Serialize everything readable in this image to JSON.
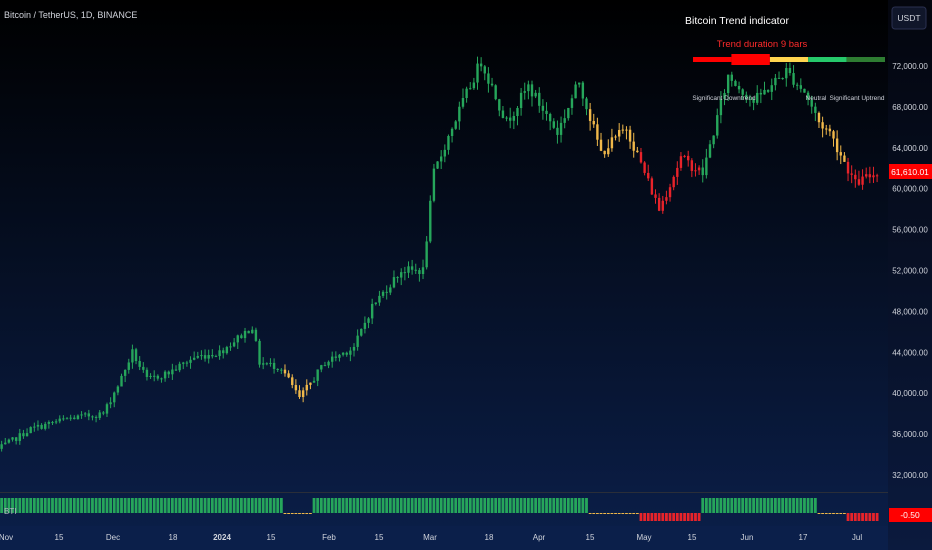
{
  "header": {
    "symbol": "Bitcoin / TetherUS, 1D, BINANCE"
  },
  "currency_button": {
    "label": "USDT"
  },
  "indicator": {
    "title": "Bitcoin Trend indicator",
    "duration_label": "Trend duration 9 bars",
    "labels": {
      "significant_downtrend": "Significant Downtrend",
      "neutral": "Neutral",
      "significant_uptrend": "Significant Uptrend"
    },
    "legend_colors": [
      "#ff0000",
      "#ff0000",
      "#ffd54f",
      "#26c96b",
      "#2e7d32"
    ],
    "current_marker_segment": 1
  },
  "price_axis": {
    "ticks": [
      "72,000.00",
      "68,000.00",
      "64,000.00",
      "60,000.00",
      "56,000.00",
      "52,000.00",
      "48,000.00",
      "44,000.00",
      "40,000.00",
      "36,000.00",
      "32,000.00"
    ],
    "last_price_label": "61,610.01",
    "last_price_color": "#ff0000"
  },
  "time_axis": {
    "ticks": [
      "Nov",
      "15",
      "Dec",
      "18",
      "2024",
      "15",
      "Feb",
      "15",
      "Mar",
      "18",
      "Apr",
      "15",
      "May",
      "15",
      "Jun",
      "17",
      "Jul"
    ]
  },
  "sub_pane": {
    "name": "BTI",
    "value_label": "-0.50",
    "value_color": "#ff0000"
  },
  "colors": {
    "background_top": "#000000",
    "background_bottom": "#0b1f4a",
    "bull_green": "#26a65b",
    "neutral_yellow": "#f0b84a",
    "bear_red": "#e8232a",
    "axis_text": "#d1d4dc"
  },
  "chart_data": {
    "type": "ohlc",
    "title": "Bitcoin / TetherUS, 1D, BINANCE",
    "ylim": [
      31000,
      75000
    ],
    "x_range": [
      "2023-11-01",
      "2024-07-03"
    ],
    "anchors": [
      {
        "date": "2023-11-01",
        "close": 34500
      },
      {
        "date": "2023-11-10",
        "close": 36500
      },
      {
        "date": "2023-11-20",
        "close": 37500
      },
      {
        "date": "2023-11-30",
        "close": 38000
      },
      {
        "date": "2023-12-05",
        "close": 41500
      },
      {
        "date": "2023-12-08",
        "close": 44000
      },
      {
        "date": "2023-12-12",
        "close": 41300
      },
      {
        "date": "2023-12-18",
        "close": 42000
      },
      {
        "date": "2023-12-25",
        "close": 43500
      },
      {
        "date": "2024-01-01",
        "close": 44000
      },
      {
        "date": "2024-01-10",
        "close": 46500
      },
      {
        "date": "2024-01-12",
        "close": 43000
      },
      {
        "date": "2024-01-18",
        "close": 42500
      },
      {
        "date": "2024-01-23",
        "close": 39500
      },
      {
        "date": "2024-01-30",
        "close": 43000
      },
      {
        "date": "2024-02-07",
        "close": 44500
      },
      {
        "date": "2024-02-12",
        "close": 48500
      },
      {
        "date": "2024-02-20",
        "close": 52000
      },
      {
        "date": "2024-02-26",
        "close": 52000
      },
      {
        "date": "2024-02-29",
        "close": 61500
      },
      {
        "date": "2024-03-05",
        "close": 66000
      },
      {
        "date": "2024-03-13",
        "close": 72500
      },
      {
        "date": "2024-03-20",
        "close": 66500
      },
      {
        "date": "2024-03-26",
        "close": 70000
      },
      {
        "date": "2024-04-03",
        "close": 65500
      },
      {
        "date": "2024-04-09",
        "close": 70500
      },
      {
        "date": "2024-04-15",
        "close": 63500
      },
      {
        "date": "2024-04-22",
        "close": 66000
      },
      {
        "date": "2024-05-01",
        "close": 58000
      },
      {
        "date": "2024-05-07",
        "close": 63000
      },
      {
        "date": "2024-05-13",
        "close": 61500
      },
      {
        "date": "2024-05-20",
        "close": 71000
      },
      {
        "date": "2024-05-27",
        "close": 68500
      },
      {
        "date": "2024-06-05",
        "close": 71500
      },
      {
        "date": "2024-06-10",
        "close": 69500
      },
      {
        "date": "2024-06-14",
        "close": 66500
      },
      {
        "date": "2024-06-17",
        "close": 65500
      },
      {
        "date": "2024-06-24",
        "close": 60500
      },
      {
        "date": "2024-06-30",
        "close": 61610
      }
    ],
    "color_phases": [
      {
        "from": "2023-11-01",
        "to": "2024-01-19",
        "state": "bull"
      },
      {
        "from": "2024-01-19",
        "to": "2024-01-27",
        "state": "neutral"
      },
      {
        "from": "2024-01-27",
        "to": "2024-04-12",
        "state": "bull"
      },
      {
        "from": "2024-04-12",
        "to": "2024-04-26",
        "state": "neutral"
      },
      {
        "from": "2024-04-26",
        "to": "2024-05-13",
        "state": "bear"
      },
      {
        "from": "2024-05-13",
        "to": "2024-06-14",
        "state": "bull"
      },
      {
        "from": "2024-06-14",
        "to": "2024-06-22",
        "state": "neutral"
      },
      {
        "from": "2024-06-22",
        "to": "2024-07-01",
        "state": "bear"
      }
    ],
    "last_close": 61610.01,
    "bti_last": -0.5
  }
}
